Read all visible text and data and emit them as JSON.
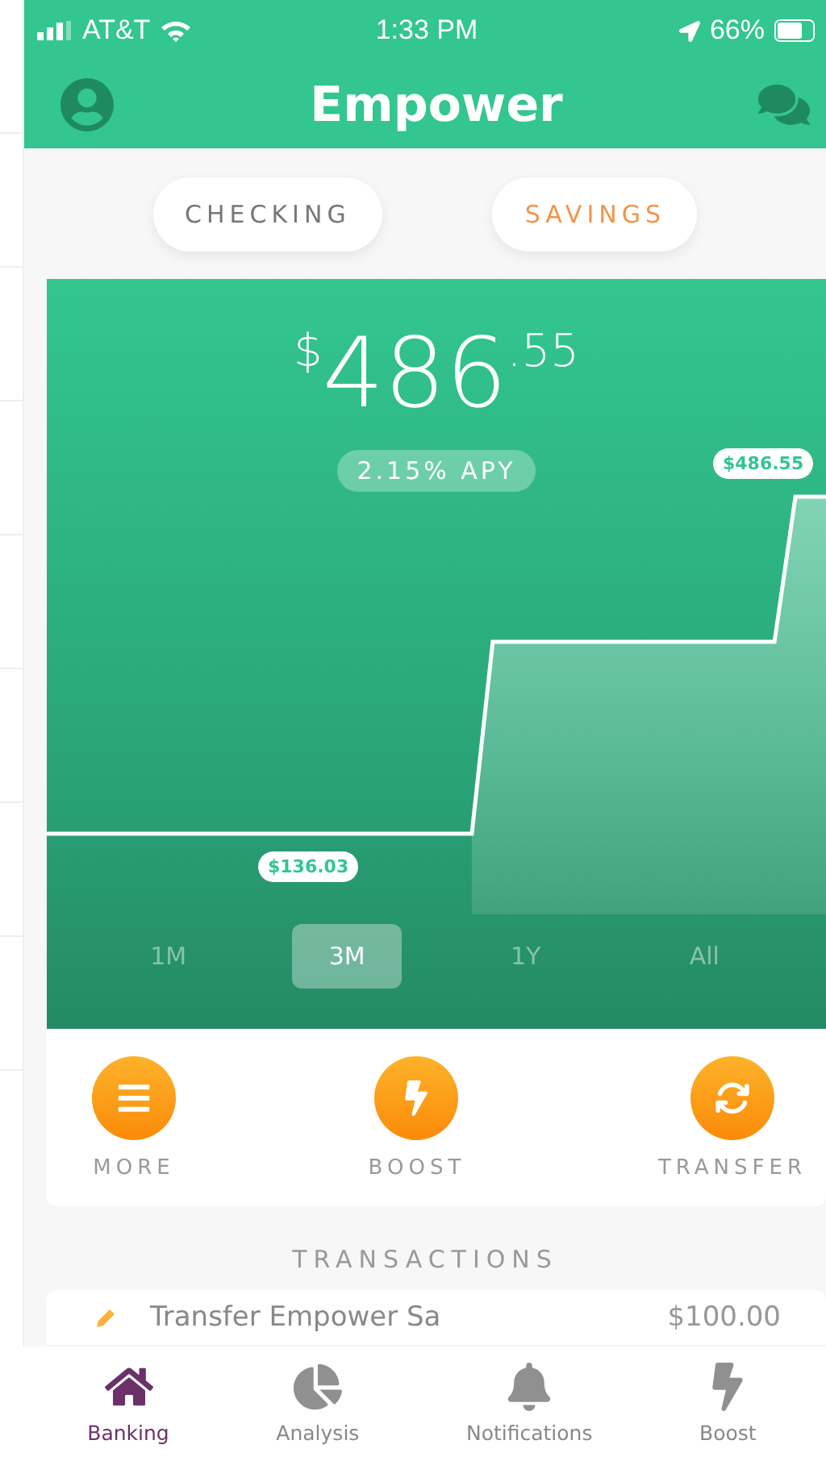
{
  "status_bar": {
    "carrier": "AT&T",
    "time": "1:33 PM",
    "battery": "66%"
  },
  "header": {
    "title": "Empower"
  },
  "account_tabs": [
    {
      "label": "CHECKING",
      "selected": false
    },
    {
      "label": "SAVINGS",
      "selected": true
    }
  ],
  "balance": {
    "currency": "$",
    "whole": "486",
    "cents": ".55",
    "apy": "2.15% APY"
  },
  "chart": {
    "high_label": "$486.55",
    "low_label": "$136.03"
  },
  "ranges": [
    {
      "label": "1M",
      "selected": false
    },
    {
      "label": "3M",
      "selected": true
    },
    {
      "label": "1Y",
      "selected": false
    },
    {
      "label": "All",
      "selected": false
    }
  ],
  "actions": [
    {
      "label": "MORE",
      "kind": "menu"
    },
    {
      "label": "BOOST",
      "kind": "bolt"
    },
    {
      "label": "TRANSFER",
      "kind": "transfer"
    }
  ],
  "transactions_title": "TRANSACTIONS",
  "transactions": [
    {
      "name": "Transfer Empower Sa",
      "amount": "$100.00"
    }
  ],
  "tab_bar": [
    {
      "label": "Banking",
      "kind": "home",
      "selected": true
    },
    {
      "label": "Analysis",
      "kind": "pie",
      "selected": false
    },
    {
      "label": "Notifications",
      "kind": "bell",
      "selected": false
    },
    {
      "label": "Boost",
      "kind": "bolt",
      "selected": false
    }
  ]
}
